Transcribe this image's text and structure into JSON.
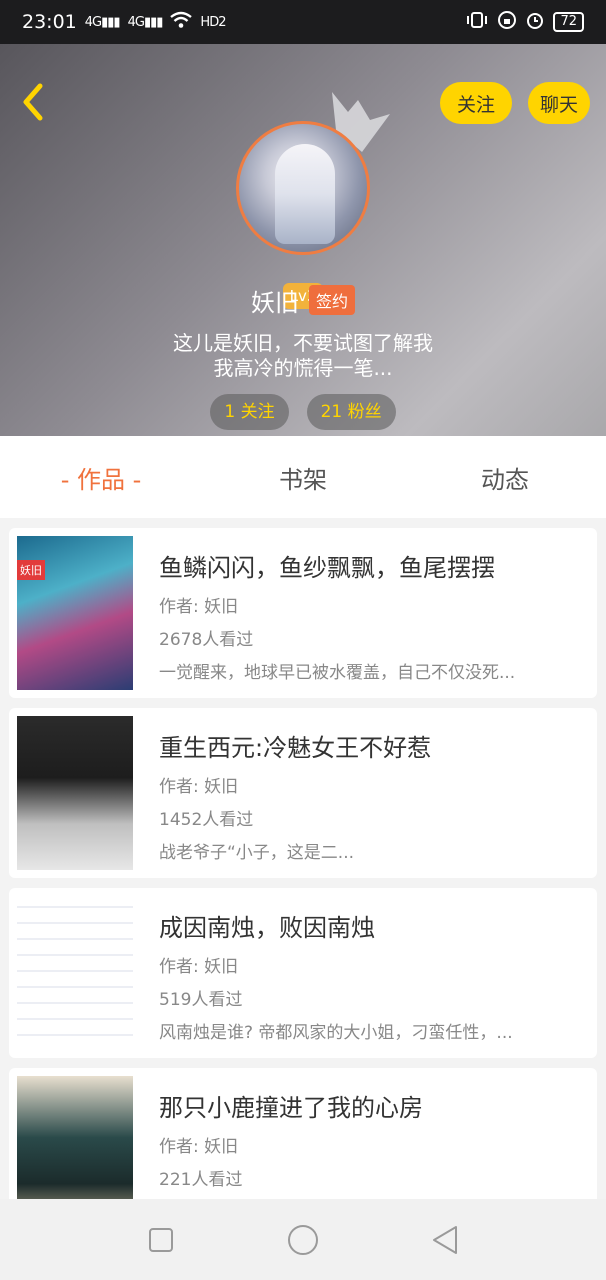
{
  "status_bar": {
    "time": "23:01",
    "net1": "4G",
    "net2": "4G",
    "hd": "HD2",
    "battery": "72"
  },
  "header": {
    "follow_label": "关注",
    "chat_label": "聊天",
    "level": "Lv3",
    "name": "妖旧",
    "sign_badge": "签约",
    "bio_line1": "这儿是妖旧，不要试图了解我",
    "bio_line2": "我高冷的慌得一笔...",
    "following": "1 关注",
    "followers": "21 粉丝"
  },
  "tabs": [
    {
      "label": "- 作品 -",
      "active": true
    },
    {
      "label": "书架",
      "active": false
    },
    {
      "label": "动态",
      "active": false
    }
  ],
  "books": [
    {
      "title": "鱼鳞闪闪，鱼纱飘飘，鱼尾摆摆",
      "author": "作者: 妖旧",
      "views": "2678人看过",
      "desc": "一觉醒来，地球早已被水覆盖，自己不仅没死...",
      "cover_tag": "妖旧"
    },
    {
      "title": "重生西元:冷魅女王不好惹",
      "author": "作者: 妖旧",
      "views": "1452人看过",
      "desc": "战老爷子“小子，这是二..."
    },
    {
      "title": "成因南烛，败因南烛",
      "author": "作者: 妖旧",
      "views": "519人看过",
      "desc": "风南烛是谁? 帝都风家的大小姐，刁蛮任性，..."
    },
    {
      "title": "那只小鹿撞进了我的心房",
      "author": "作者: 妖旧",
      "views": "221人看过",
      "desc": ""
    }
  ],
  "colors": {
    "accent": "#f0723d",
    "yellow": "#ffd400",
    "badge": "#ef6e3d"
  }
}
